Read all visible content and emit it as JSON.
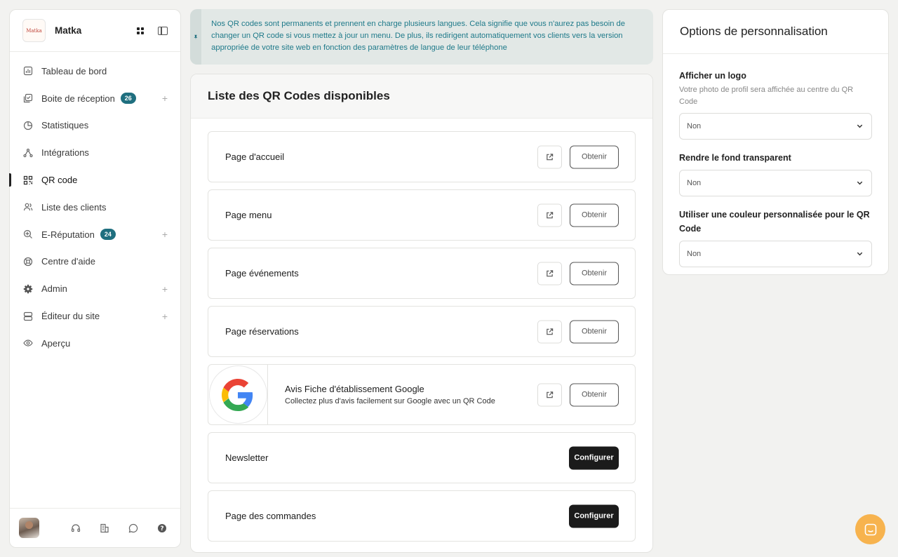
{
  "sidebar": {
    "brand": {
      "name": "Matka",
      "logo_text": "Matka"
    },
    "items": [
      {
        "label": "Tableau de bord",
        "icon": "chart-icon"
      },
      {
        "label": "Boite de réception",
        "icon": "inbox-icon",
        "badge": "26",
        "expandable": true
      },
      {
        "label": "Statistiques",
        "icon": "pie-icon"
      },
      {
        "label": "Intégrations",
        "icon": "integration-icon"
      },
      {
        "label": "QR code",
        "icon": "qr-icon",
        "active": true
      },
      {
        "label": "Liste des clients",
        "icon": "users-icon"
      },
      {
        "label": "E-Réputation",
        "icon": "reputation-icon",
        "badge": "24",
        "expandable": true
      },
      {
        "label": "Centre d'aide",
        "icon": "help-center-icon"
      },
      {
        "label": "Admin",
        "icon": "gear-icon",
        "expandable": true
      },
      {
        "label": "Éditeur du site",
        "icon": "site-editor-icon",
        "expandable": true
      },
      {
        "label": "Aperçu",
        "icon": "eye-icon"
      }
    ]
  },
  "info": {
    "text": "Nos QR codes sont permanents et prennent en charge plusieurs langues. Cela signifie que vous n'aurez pas besoin de changer un QR code si vous mettez à jour un menu. De plus, ils redirigent automatiquement vos clients vers la version appropriée de votre site web en fonction des paramètres de langue de leur téléphone"
  },
  "qr": {
    "title": "Liste des QR Codes disponibles",
    "get_label": "Obtenir",
    "configure_label": "Configurer",
    "rows": [
      {
        "label": "Page d'accueil"
      },
      {
        "label": "Page menu"
      },
      {
        "label": "Page événements"
      },
      {
        "label": "Page réservations"
      }
    ],
    "google": {
      "title": "Avis Fiche d'établissement Google",
      "subtitle": "Collectez plus d'avis facilement sur Google avec un QR Code"
    },
    "config_rows": [
      {
        "label": "Newsletter"
      },
      {
        "label": "Page des commandes"
      }
    ]
  },
  "options": {
    "title": "Options de personnalisation",
    "logo": {
      "label": "Afficher un logo",
      "help": "Votre photo de profil sera affichée au centre du QR Code",
      "value": "Non"
    },
    "transparent": {
      "label": "Rendre le fond transparent",
      "value": "Non"
    },
    "color": {
      "label": "Utiliser une couleur personnalisée pour le QR Code",
      "value": "Non"
    }
  },
  "colors": {
    "accent": "#1f6f7f",
    "chat": "#f7b34e",
    "dark_button": "#1b1b1b"
  }
}
